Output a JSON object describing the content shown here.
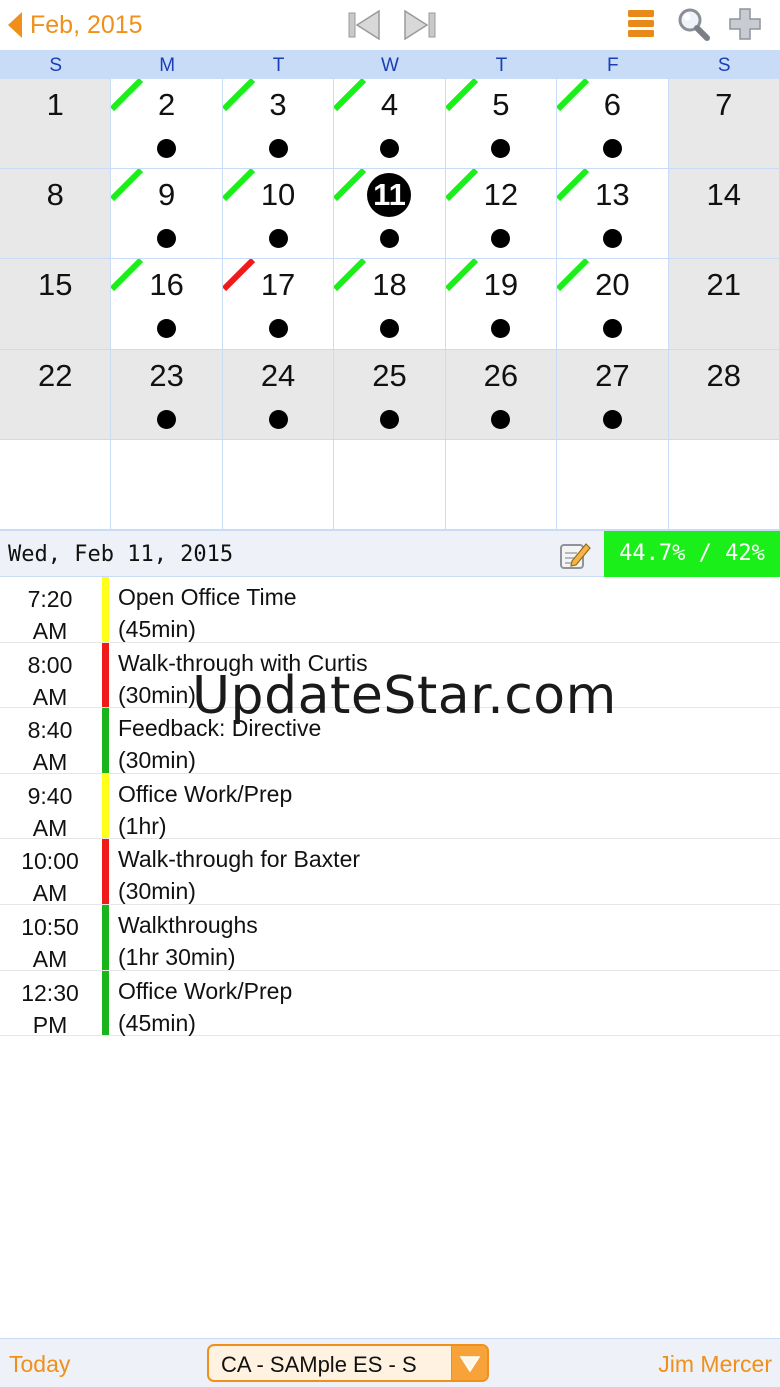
{
  "header": {
    "month_label": "Feb, 2015",
    "icons": [
      "back-arrow-icon",
      "prev-week-icon",
      "next-week-icon",
      "list-view-icon",
      "search-icon",
      "add-icon"
    ],
    "accent_color": "#f0901a"
  },
  "calendar": {
    "weekdays": [
      "S",
      "M",
      "T",
      "W",
      "T",
      "F",
      "S"
    ],
    "days": [
      {
        "day": "1",
        "dot": false,
        "mark": "",
        "style": "weekend"
      },
      {
        "day": "2",
        "dot": true,
        "mark": "green",
        "style": "normal"
      },
      {
        "day": "3",
        "dot": true,
        "mark": "green",
        "style": "normal"
      },
      {
        "day": "4",
        "dot": true,
        "mark": "green",
        "style": "normal"
      },
      {
        "day": "5",
        "dot": true,
        "mark": "green",
        "style": "normal"
      },
      {
        "day": "6",
        "dot": true,
        "mark": "green",
        "style": "normal"
      },
      {
        "day": "7",
        "dot": false,
        "mark": "",
        "style": "weekend"
      },
      {
        "day": "8",
        "dot": false,
        "mark": "",
        "style": "weekend"
      },
      {
        "day": "9",
        "dot": true,
        "mark": "green",
        "style": "normal"
      },
      {
        "day": "10",
        "dot": true,
        "mark": "green",
        "style": "normal"
      },
      {
        "day": "11",
        "dot": true,
        "mark": "green",
        "style": "today"
      },
      {
        "day": "12",
        "dot": true,
        "mark": "green",
        "style": "normal"
      },
      {
        "day": "13",
        "dot": true,
        "mark": "green",
        "style": "normal"
      },
      {
        "day": "14",
        "dot": false,
        "mark": "",
        "style": "weekend"
      },
      {
        "day": "15",
        "dot": false,
        "mark": "",
        "style": "weekend"
      },
      {
        "day": "16",
        "dot": true,
        "mark": "green",
        "style": "normal"
      },
      {
        "day": "17",
        "dot": true,
        "mark": "red",
        "style": "normal"
      },
      {
        "day": "18",
        "dot": true,
        "mark": "green",
        "style": "normal"
      },
      {
        "day": "19",
        "dot": true,
        "mark": "green",
        "style": "normal"
      },
      {
        "day": "20",
        "dot": true,
        "mark": "green",
        "style": "normal"
      },
      {
        "day": "21",
        "dot": false,
        "mark": "",
        "style": "weekend"
      },
      {
        "day": "22",
        "dot": false,
        "mark": "",
        "style": "gray"
      },
      {
        "day": "23",
        "dot": true,
        "mark": "",
        "style": "gray"
      },
      {
        "day": "24",
        "dot": true,
        "mark": "",
        "style": "gray"
      },
      {
        "day": "25",
        "dot": true,
        "mark": "",
        "style": "gray"
      },
      {
        "day": "26",
        "dot": true,
        "mark": "",
        "style": "gray"
      },
      {
        "day": "27",
        "dot": true,
        "mark": "",
        "style": "gray"
      },
      {
        "day": "28",
        "dot": false,
        "mark": "",
        "style": "gray"
      },
      {
        "day": "",
        "dot": false,
        "mark": "",
        "style": "empty"
      },
      {
        "day": "",
        "dot": false,
        "mark": "",
        "style": "empty"
      },
      {
        "day": "",
        "dot": false,
        "mark": "",
        "style": "empty"
      },
      {
        "day": "",
        "dot": false,
        "mark": "",
        "style": "empty"
      },
      {
        "day": "",
        "dot": false,
        "mark": "",
        "style": "empty"
      },
      {
        "day": "",
        "dot": false,
        "mark": "",
        "style": "empty"
      },
      {
        "day": "",
        "dot": false,
        "mark": "",
        "style": "empty"
      }
    ],
    "mark_colors": {
      "green": "#1aef1a",
      "red": "#ef1a1a"
    }
  },
  "day_panel": {
    "title": "Wed, Feb 11, 2015",
    "percent": "44.7% / 42%",
    "edit_icon": "edit-note-icon",
    "percent_color": "#1aef1a"
  },
  "events": [
    {
      "time": "7:20",
      "ampm": "AM",
      "title": "Open Office Time",
      "duration": "(45min)",
      "color": "#ffff1a"
    },
    {
      "time": "8:00",
      "ampm": "AM",
      "title": "Walk-through with Curtis",
      "duration": "(30min)",
      "color": "#ef1a1a"
    },
    {
      "time": "8:40",
      "ampm": "AM",
      "title": "Feedback: Directive",
      "duration": "(30min)",
      "color": "#1ab51a"
    },
    {
      "time": "9:40",
      "ampm": "AM",
      "title": "Office Work/Prep",
      "duration": "(1hr)",
      "color": "#ffff1a"
    },
    {
      "time": "10:00",
      "ampm": "AM",
      "title": "Walk-through for Baxter",
      "duration": "(30min)",
      "color": "#ef1a1a"
    },
    {
      "time": "10:50",
      "ampm": "AM",
      "title": "Walkthroughs",
      "duration": "(1hr 30min)",
      "color": "#1ab51a"
    },
    {
      "time": "12:30",
      "ampm": "PM",
      "title": "Office Work/Prep",
      "duration": "(45min)",
      "color": "#1ab51a"
    }
  ],
  "watermark": "UpdateStar.com",
  "footer": {
    "today_label": "Today",
    "selector_label": "CA - SAMple ES - S",
    "user_label": "Jim Mercer"
  }
}
